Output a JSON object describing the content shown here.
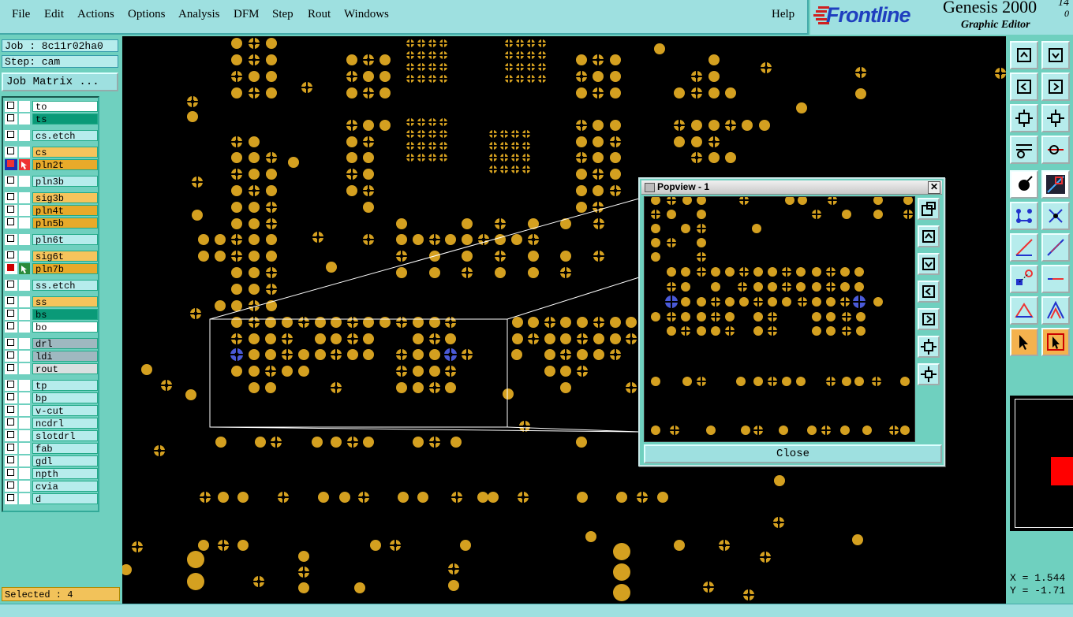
{
  "menubar": {
    "items": [
      "File",
      "Edit",
      "Actions",
      "Options",
      "Analysis",
      "DFM",
      "Step",
      "Rout",
      "Windows"
    ],
    "help": "Help"
  },
  "logo": {
    "brand": "Frontline",
    "product": "Genesis 2000",
    "version_top": "14",
    "version_bottom": "0",
    "subtitle": "Graphic Editor"
  },
  "job": {
    "job_label": "Job : 8c11r02ha0",
    "step_label": "Step: cam",
    "matrix_button": "Job Matrix ..."
  },
  "layers": [
    {
      "name": "to",
      "color": "#ffffff"
    },
    {
      "name": "ts",
      "color": "#0a9a78"
    },
    {
      "name": "cs.etch",
      "color": "#b6ecec"
    },
    {
      "name": "cs",
      "color": "#f6c45c"
    },
    {
      "name": "pln2t",
      "color": "#e8aa2a",
      "work": true
    },
    {
      "name": "pln3b",
      "color": "#b6ecec"
    },
    {
      "name": "sig3b",
      "color": "#f6c45c"
    },
    {
      "name": "pln4t",
      "color": "#e8aa2a"
    },
    {
      "name": "pln5b",
      "color": "#e8aa2a"
    },
    {
      "name": "pln6t",
      "color": "#b6ecec"
    },
    {
      "name": "sig6t",
      "color": "#f6c45c"
    },
    {
      "name": "pln7b",
      "color": "#e8aa2a",
      "affected": true
    },
    {
      "name": "ss.etch",
      "color": "#b6ecec"
    },
    {
      "name": "ss",
      "color": "#f6c45c"
    },
    {
      "name": "bs",
      "color": "#0a9a78"
    },
    {
      "name": "bo",
      "color": "#ffffff"
    },
    {
      "name": "drl",
      "color": "#9fb8c0"
    },
    {
      "name": "ldi",
      "color": "#9fb8c0"
    },
    {
      "name": "rout",
      "color": "#d8e0e0"
    },
    {
      "name": "tp",
      "color": "#b6ecec"
    },
    {
      "name": "bp",
      "color": "#b6ecec"
    },
    {
      "name": "v-cut",
      "color": "#b6ecec"
    },
    {
      "name": "ncdrl",
      "color": "#b6ecec"
    },
    {
      "name": "slotdrl",
      "color": "#b6ecec"
    },
    {
      "name": "fab",
      "color": "#b6ecec"
    },
    {
      "name": "gdl",
      "color": "#b6ecec"
    },
    {
      "name": "npth",
      "color": "#b6ecec"
    },
    {
      "name": "cvia",
      "color": "#b6ecec"
    },
    {
      "name": "d",
      "color": "#b6ecec"
    }
  ],
  "status": {
    "selected": "Selected : 4"
  },
  "popview": {
    "title": "Popview - 1",
    "close_button": "Close",
    "close_x": "✕"
  },
  "coords": {
    "x": "X = 1.544",
    "y": "Y = -1.71"
  },
  "colors": {
    "pad": "#d4a020",
    "selected_pad": "#4a5ad8",
    "canvas": "#000000",
    "panel": "#6fd0bf"
  }
}
